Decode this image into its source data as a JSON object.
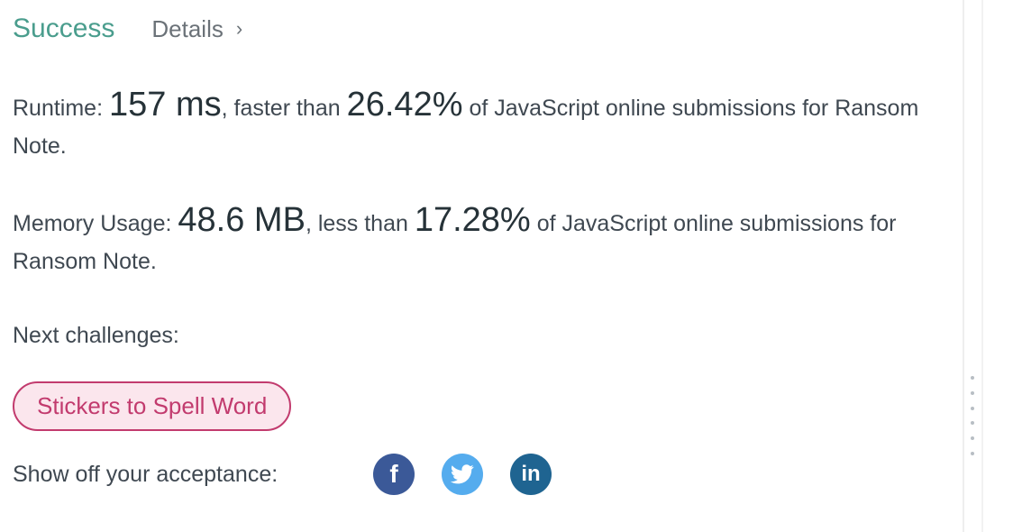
{
  "header": {
    "status": "Success",
    "details_label": "Details",
    "details_chevron": "›"
  },
  "runtime": {
    "label": "Runtime:",
    "value": "157 ms",
    "mid_text": ", faster than",
    "percent": "26.42%",
    "tail_text": "of JavaScript online submissions for Ransom Note."
  },
  "memory": {
    "label": "Memory Usage:",
    "value": "48.6 MB",
    "mid_text": ", less than",
    "percent": "17.28%",
    "tail_text": "of JavaScript online submissions for Ransom Note."
  },
  "next": {
    "label": "Next challenges:",
    "challenges": [
      "Stickers to Spell Word"
    ]
  },
  "share": {
    "label": "Show off your acceptance:",
    "icons": [
      "facebook-icon",
      "twitter-icon",
      "linkedin-icon"
    ],
    "facebook_glyph": "f",
    "linkedin_glyph": "in"
  },
  "colors": {
    "success": "#4a9d8d",
    "challenge": "#c23b6e",
    "facebook": "#3b5998",
    "twitter": "#55acee",
    "linkedin": "#1f6491"
  }
}
